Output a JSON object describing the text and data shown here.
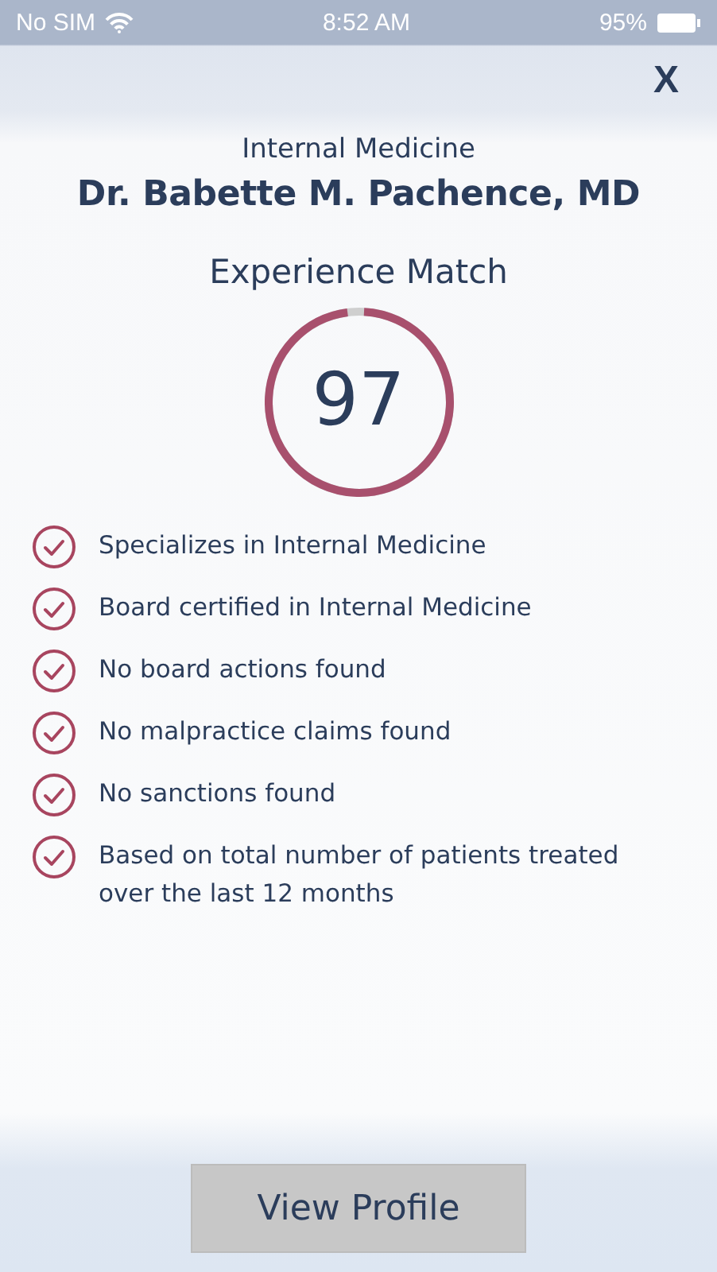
{
  "status_bar": {
    "carrier": "No SIM",
    "time": "8:52 AM",
    "battery": "95%"
  },
  "close": {
    "label": "X"
  },
  "specialty": "Internal Medicine",
  "doctor_name": "Dr. Babette M. Pachence, MD",
  "match": {
    "title": "Experience Match",
    "score": "97"
  },
  "criteria": [
    {
      "text": "Specializes in Internal Medicine",
      "checked": true
    },
    {
      "text": "Board certified in Internal Medicine",
      "checked": true
    },
    {
      "text": "No board actions found",
      "checked": true
    },
    {
      "text": "No malpractice claims found",
      "checked": true
    },
    {
      "text": "No sanctions found",
      "checked": true
    },
    {
      "text": "Based on total number of patients treated over the last 12 months",
      "checked": true
    }
  ],
  "button": {
    "label": "View Profile"
  }
}
